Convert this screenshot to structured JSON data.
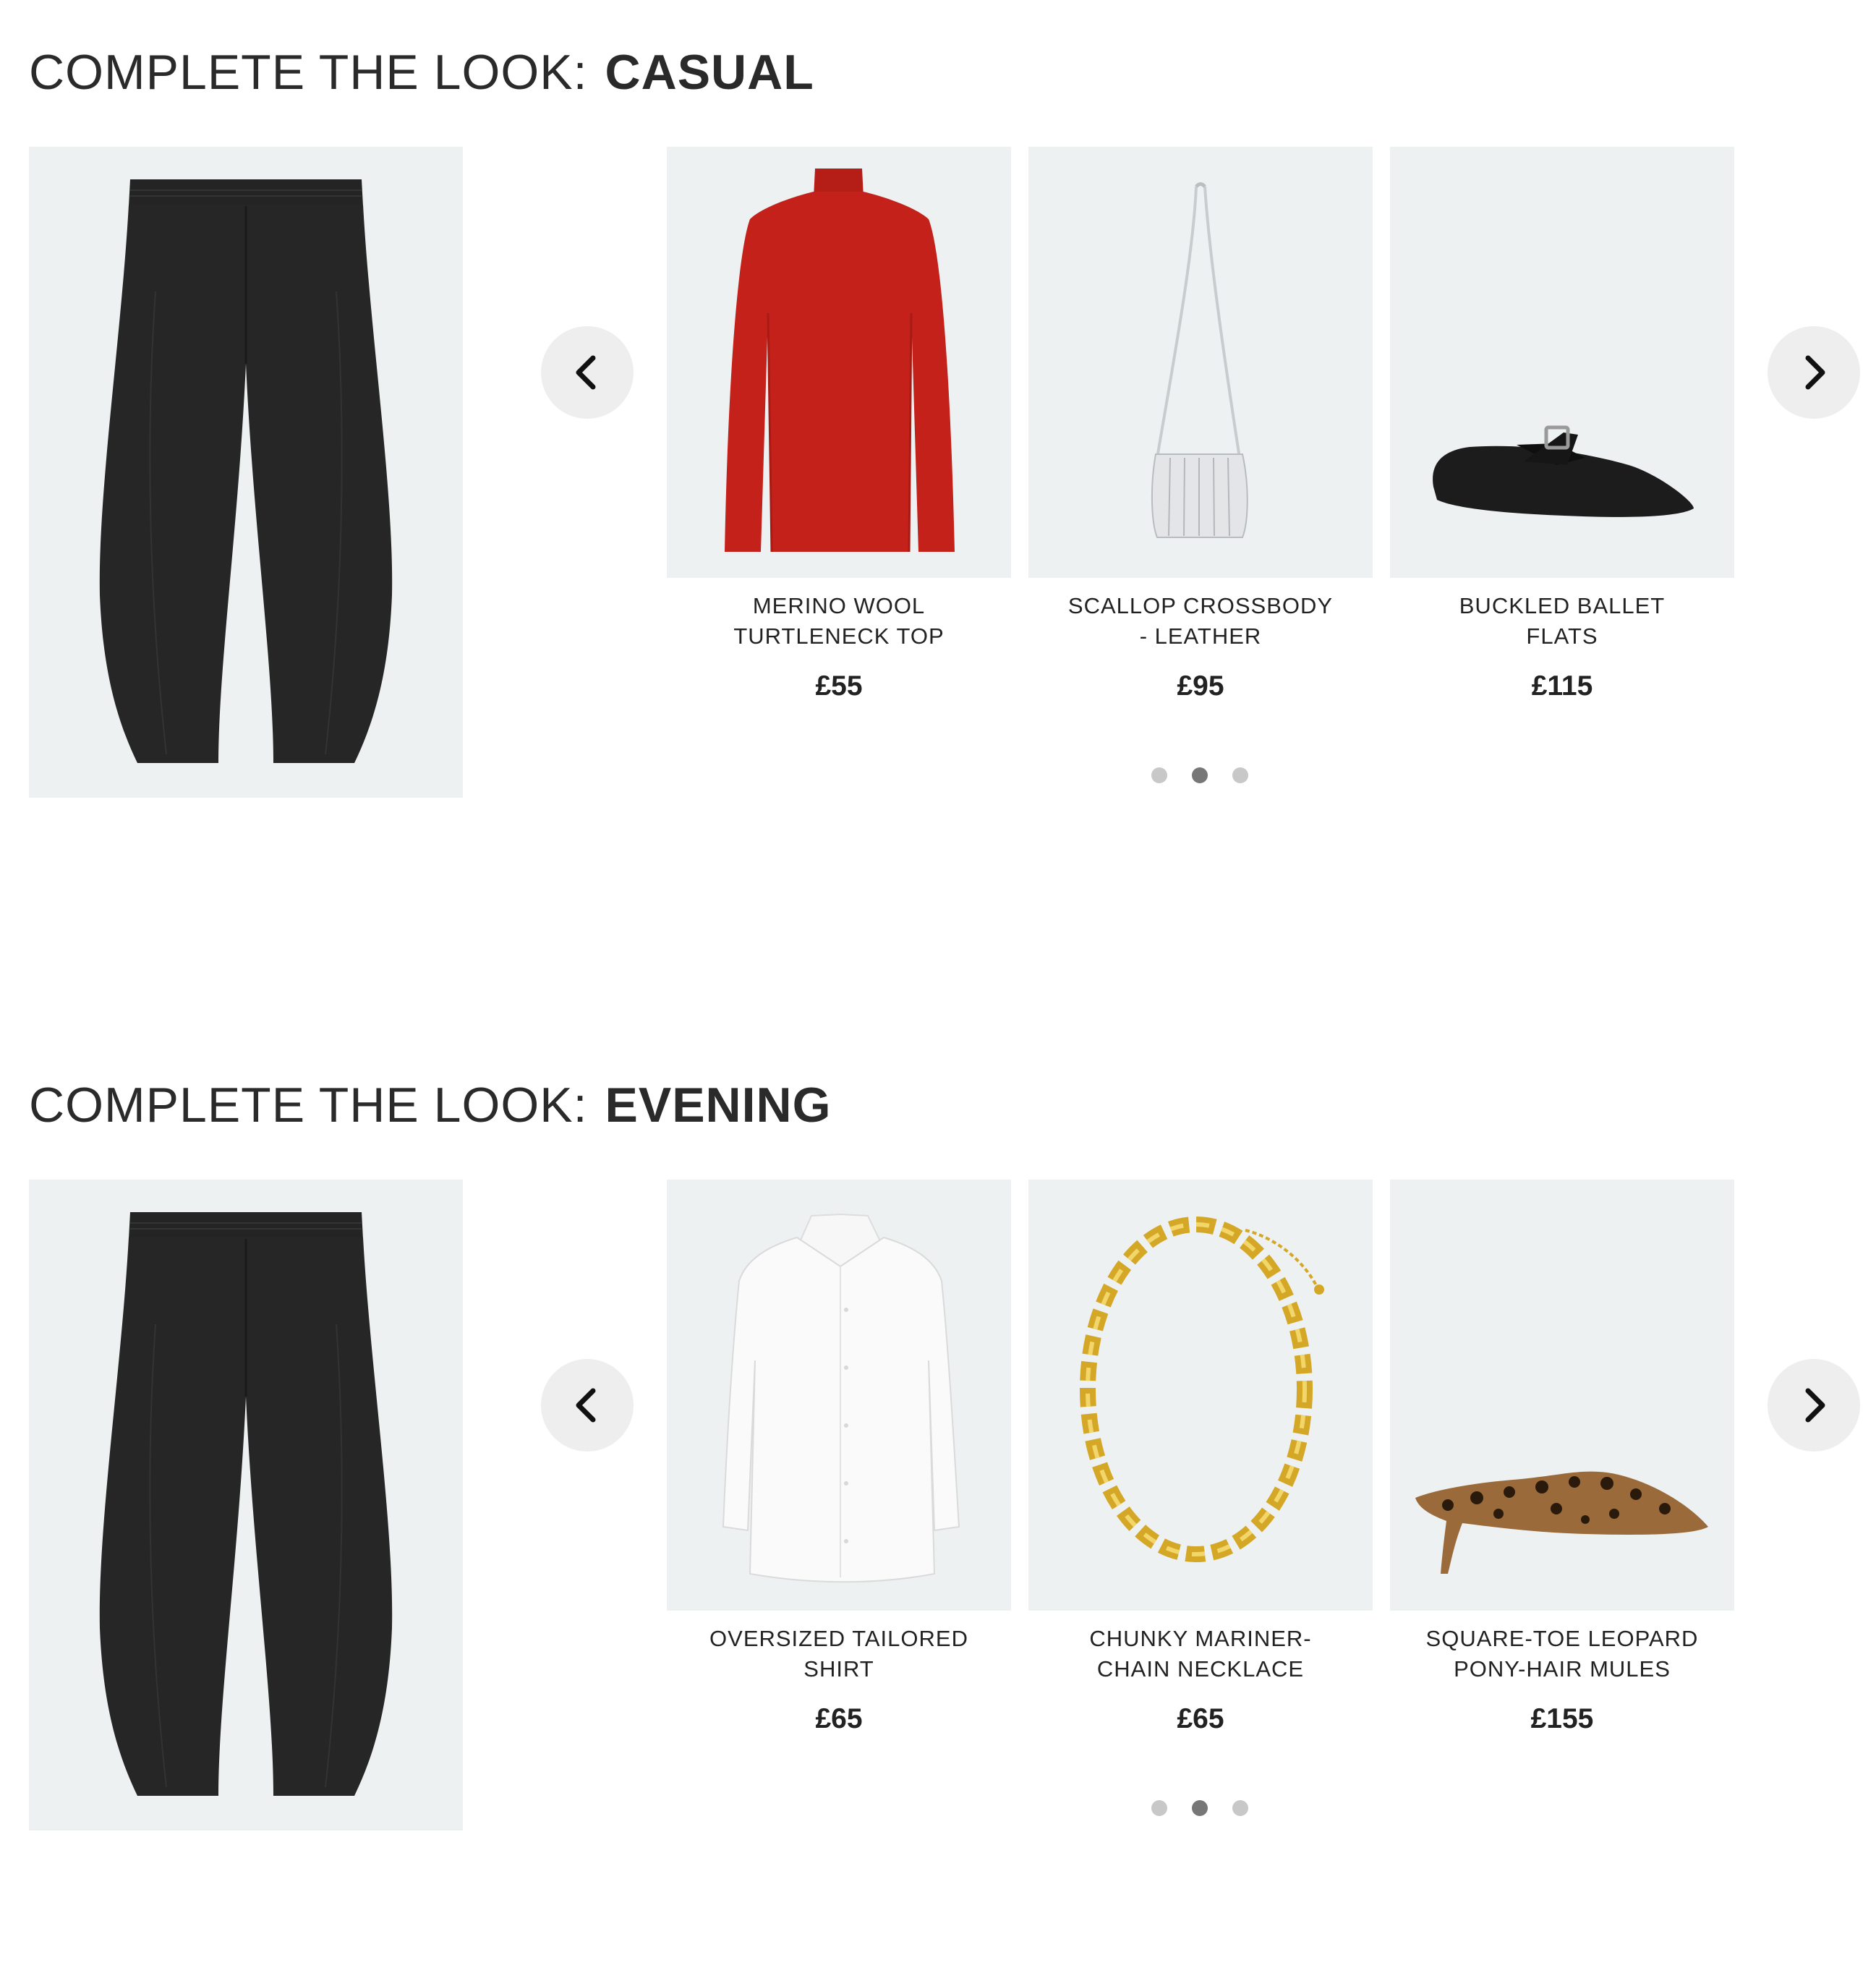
{
  "sections": [
    {
      "heading_prefix": "COMPLETE THE LOOK:",
      "heading_style": "CASUAL",
      "hero_icon": "black-barrel-trousers",
      "prev_icon": "chevron-left-icon",
      "next_icon": "chevron-right-icon",
      "products": [
        {
          "name": "MERINO WOOL TURTLENECK TOP",
          "price": "£55",
          "image_icon": "red-turtleneck",
          "color": "#c4211b"
        },
        {
          "name": "SCALLOP CROSSBODY - LEATHER",
          "price": "£95",
          "image_icon": "silver-crossbody-bag",
          "color": "#d9dcde"
        },
        {
          "name": "BUCKLED BALLET FLATS",
          "price": "£115",
          "image_icon": "black-ballet-flat",
          "color": "#1c1c1c"
        }
      ],
      "pagination": {
        "count": 3,
        "active": 2
      }
    },
    {
      "heading_prefix": "COMPLETE THE LOOK:",
      "heading_style": "EVENING",
      "hero_icon": "black-barrel-trousers",
      "prev_icon": "chevron-left-icon",
      "next_icon": "chevron-right-icon",
      "products": [
        {
          "name": "OVERSIZED TAILORED SHIRT",
          "price": "£65",
          "image_icon": "white-shirt",
          "color": "#ffffff"
        },
        {
          "name": "CHUNKY MARINER-CHAIN NECKLACE",
          "price": "£65",
          "image_icon": "gold-chain-necklace",
          "color": "#d4a826"
        },
        {
          "name": "SQUARE-TOE LEOPARD PONY-HAIR MULES",
          "price": "£155",
          "image_icon": "leopard-mule",
          "color": "#9a6a3a"
        }
      ],
      "pagination": {
        "count": 3,
        "active": 2
      }
    }
  ]
}
